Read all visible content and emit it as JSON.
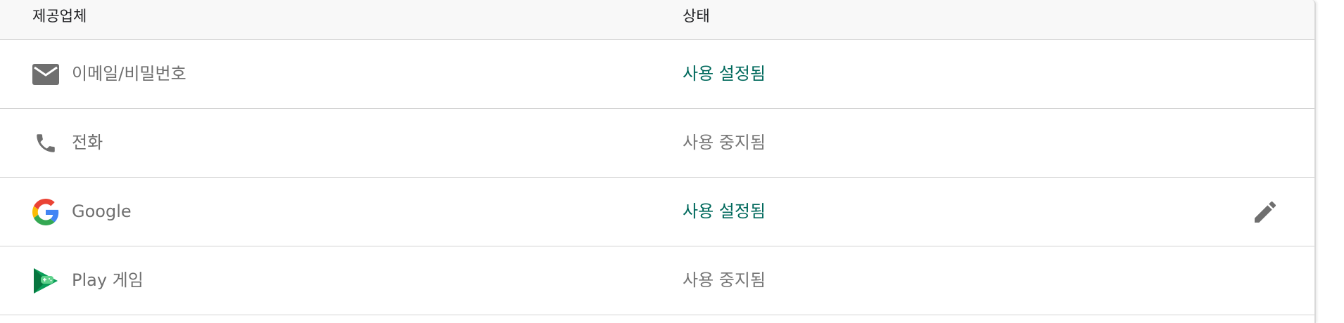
{
  "table": {
    "headers": {
      "provider": "제공업체",
      "status": "상태"
    },
    "rows": [
      {
        "icon": "email-icon",
        "name": "이메일/비밀번호",
        "status": "사용 설정됨",
        "state": "enabled"
      },
      {
        "icon": "phone-icon",
        "name": "전화",
        "status": "사용 중지됨",
        "state": "disabled"
      },
      {
        "icon": "google-icon",
        "name": "Google",
        "status": "사용 설정됨",
        "state": "enabled",
        "editable": true
      },
      {
        "icon": "play-games-icon",
        "name": "Play 게임",
        "status": "사용 중지됨",
        "state": "disabled"
      }
    ]
  },
  "colors": {
    "enabled": "#00695c",
    "disabled": "#767676",
    "icon_gray": "#6f6f6f"
  }
}
